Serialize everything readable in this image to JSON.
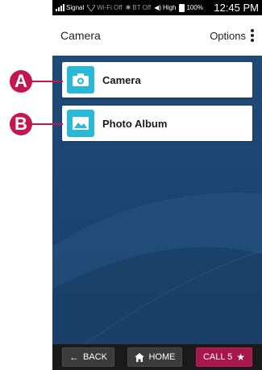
{
  "status_bar": {
    "signal_label": "Signal",
    "wifi_label": "Wi-Fi Off",
    "bt_label": "BT Off",
    "volume_label": "High",
    "battery_label": "100%",
    "time": "12:45 PM"
  },
  "header": {
    "title": "Camera",
    "options_label": "Options"
  },
  "menu": {
    "items": [
      {
        "label": "Camera",
        "icon": "camera-icon",
        "callout": "A"
      },
      {
        "label": "Photo Album",
        "icon": "photo-album-icon",
        "callout": "B"
      }
    ]
  },
  "bottom_bar": {
    "back_label": "BACK",
    "home_label": "HOME",
    "call_label": "CALL 5",
    "call_star": "★"
  },
  "colors": {
    "accent_teal": "#29b8d6",
    "callout_magenta": "#c4174f",
    "call_button": "#a8174c",
    "background_blue": "#1f4a78"
  }
}
